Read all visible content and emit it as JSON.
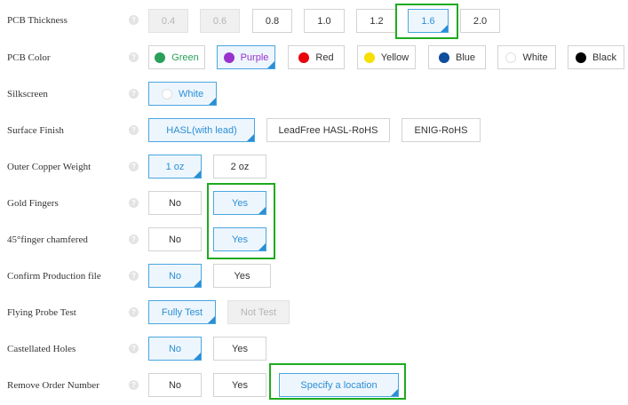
{
  "help_glyph": "?",
  "pcb_thickness": {
    "label": "PCB Thickness",
    "options": [
      "0.4",
      "0.6",
      "0.8",
      "1.0",
      "1.2",
      "1.6",
      "2.0"
    ],
    "selected": "1.6",
    "disabled": [
      "0.4",
      "0.6"
    ]
  },
  "pcb_color": {
    "label": "PCB Color",
    "options": [
      "Green",
      "Purple",
      "Red",
      "Yellow",
      "Blue",
      "White",
      "Black"
    ],
    "selected": "Purple",
    "swatches": {
      "Green": "#2ca05a",
      "Purple": "#9932cc",
      "Red": "#e8000b",
      "Yellow": "#f5e000",
      "Blue": "#0f4d9e",
      "White": "#ffffff",
      "Black": "#000000"
    }
  },
  "silkscreen": {
    "label": "Silkscreen",
    "options": [
      "White"
    ],
    "selected": "White",
    "swatch": "#ffffff"
  },
  "surface_finish": {
    "label": "Surface Finish",
    "options": [
      "HASL(with lead)",
      "LeadFree HASL-RoHS",
      "ENIG-RoHS"
    ],
    "selected": "HASL(with lead)"
  },
  "outer_copper_weight": {
    "label": "Outer Copper Weight",
    "options": [
      "1 oz",
      "2 oz"
    ],
    "selected": "1 oz"
  },
  "gold_fingers": {
    "label": "Gold Fingers",
    "options": [
      "No",
      "Yes"
    ],
    "selected": "Yes"
  },
  "finger_chamfered": {
    "label": "45°finger chamfered",
    "options": [
      "No",
      "Yes"
    ],
    "selected": "Yes"
  },
  "confirm_production_file": {
    "label": "Confirm Production file",
    "options": [
      "No",
      "Yes"
    ],
    "selected": "No"
  },
  "flying_probe_test": {
    "label": "Flying Probe Test",
    "options": [
      "Fully Test",
      "Not Test"
    ],
    "selected": "Fully Test",
    "disabled": [
      "Not Test"
    ]
  },
  "castellated_holes": {
    "label": "Castellated Holes",
    "options": [
      "No",
      "Yes"
    ],
    "selected": "No"
  },
  "remove_order_number": {
    "label": "Remove Order Number",
    "options": [
      "No",
      "Yes",
      "Specify a location"
    ],
    "selected": "Specify a location"
  },
  "colors": {
    "accent": "#2a8fd6",
    "highlight": "#1faa1f",
    "border": "#d3d3d3",
    "disabled_bg": "#f0f0f0"
  }
}
